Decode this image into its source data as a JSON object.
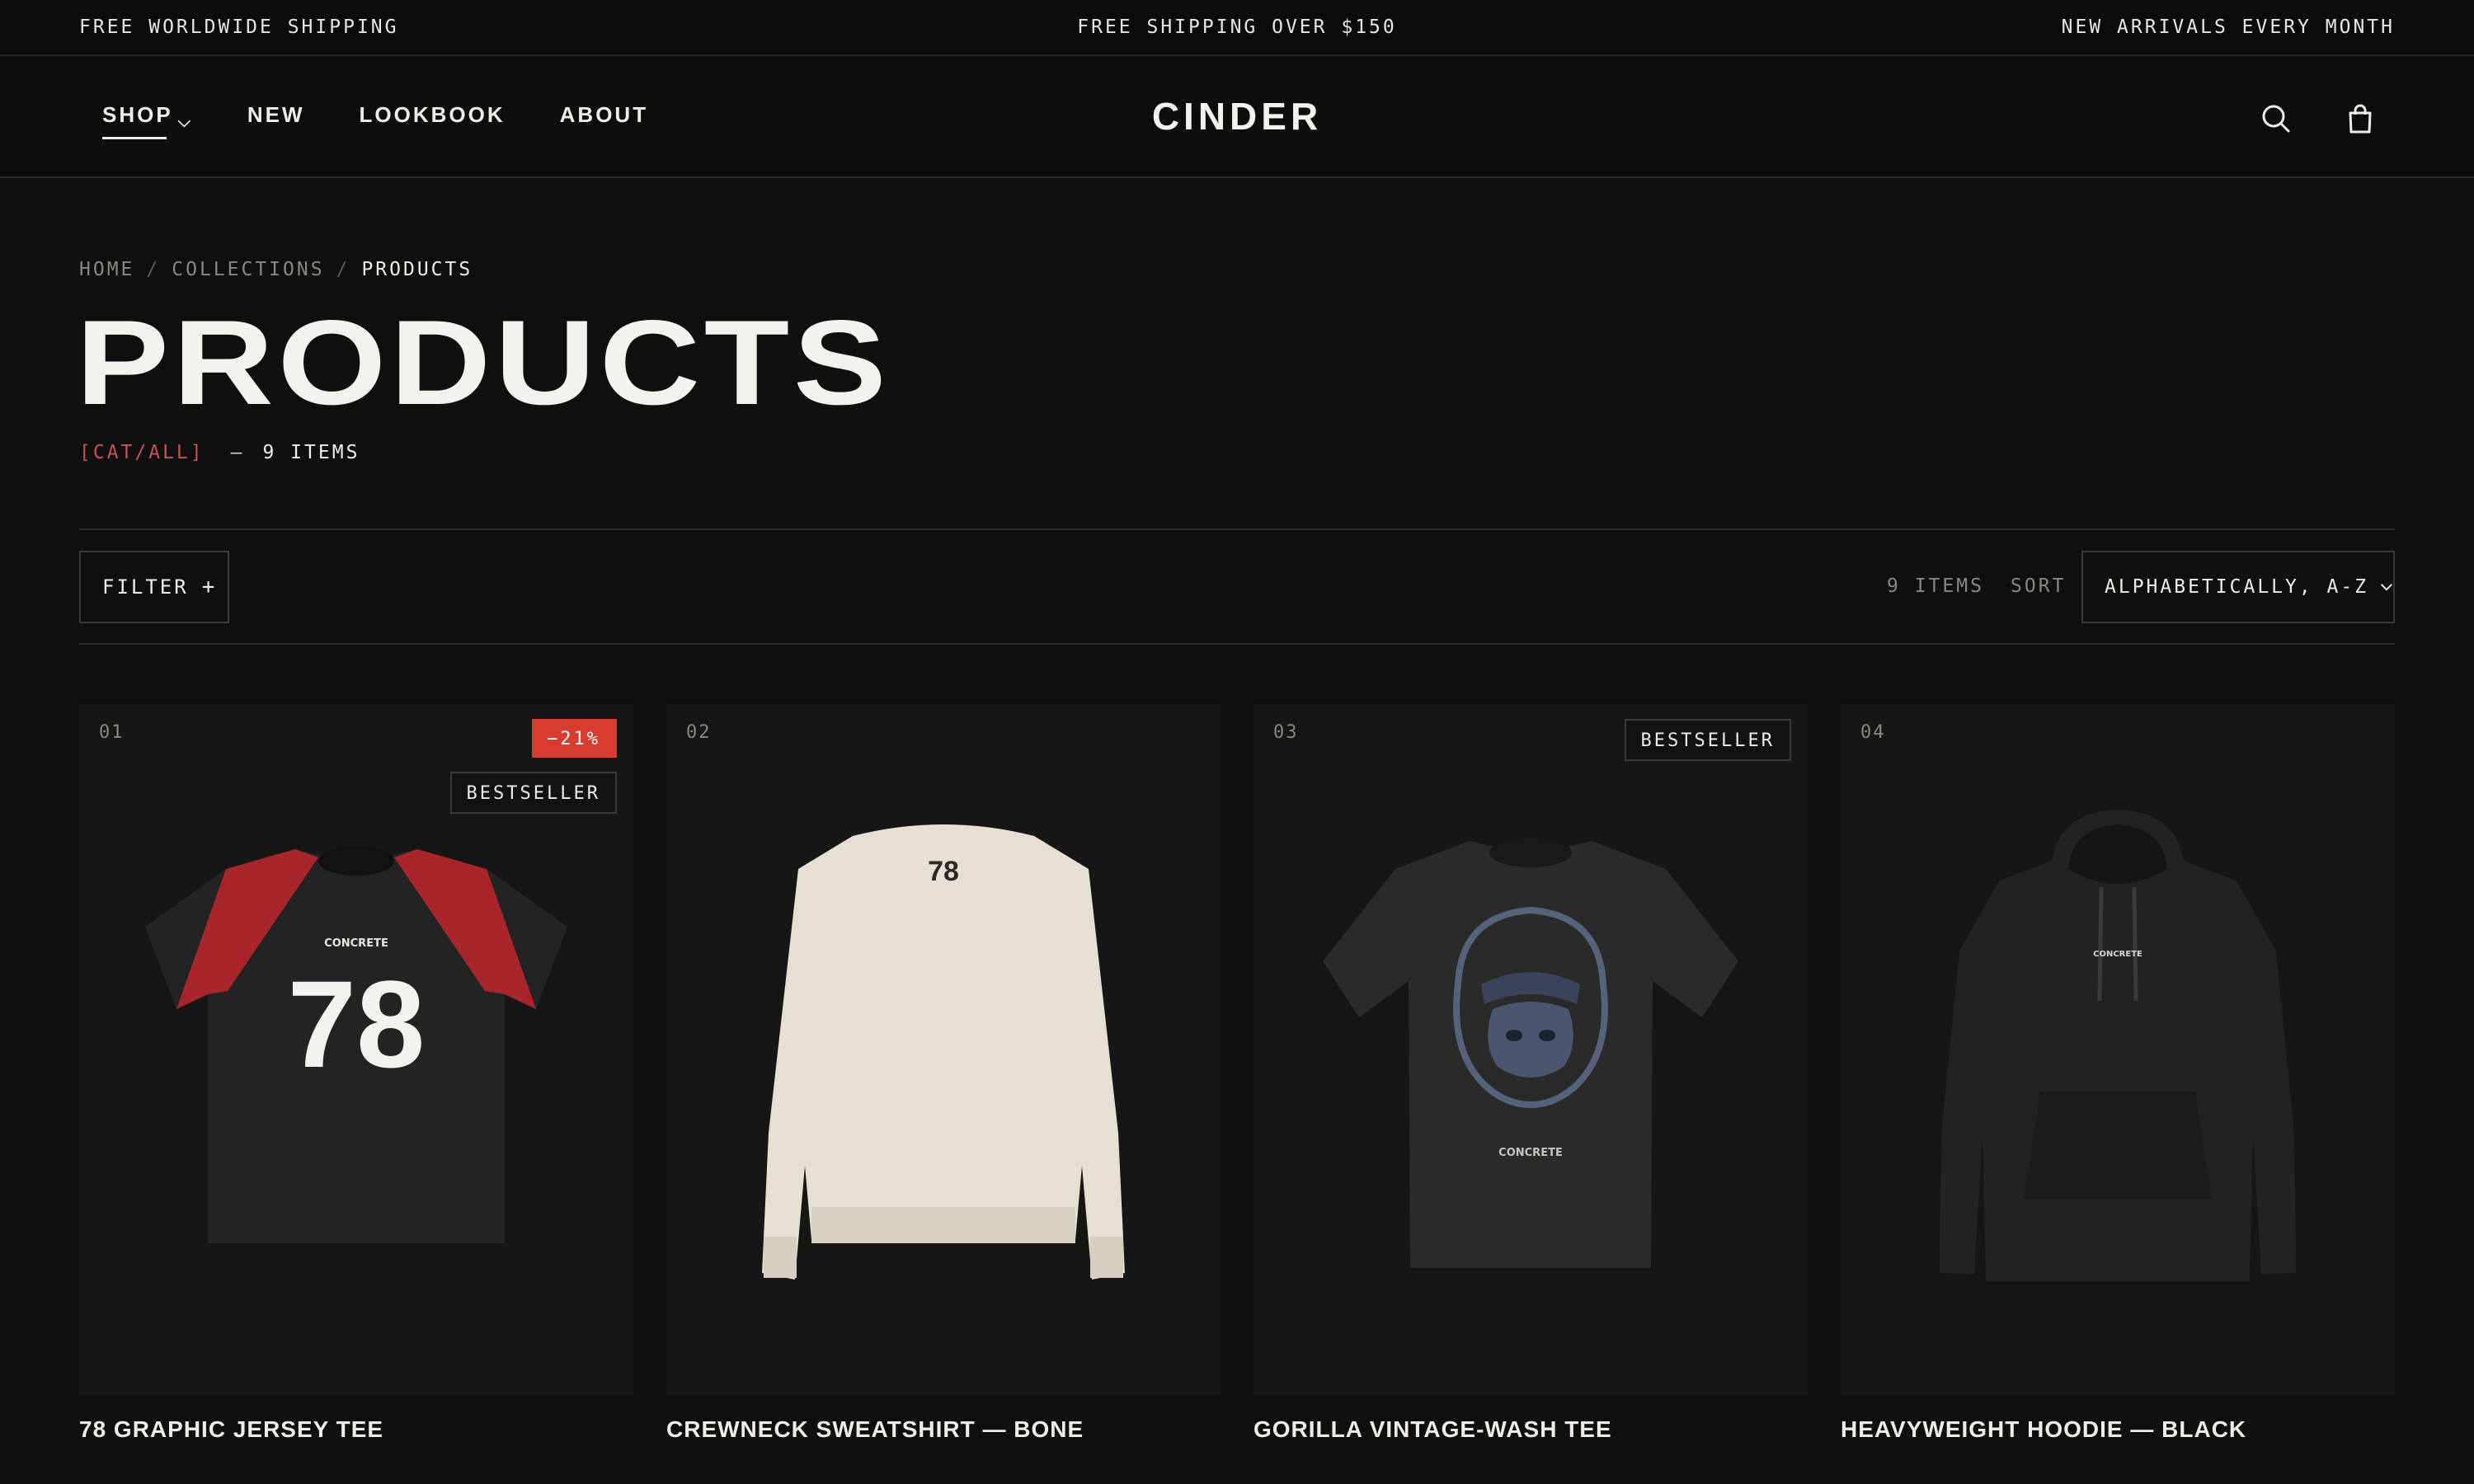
{
  "announcement": {
    "left": "FREE WORLDWIDE SHIPPING",
    "center": "FREE SHIPPING OVER $150",
    "right": "NEW ARRIVALS EVERY MONTH"
  },
  "header": {
    "logo": "CINDER",
    "nav": [
      {
        "label": "SHOP",
        "active": true,
        "has_dropdown": true
      },
      {
        "label": "NEW"
      },
      {
        "label": "LOOKBOOK"
      },
      {
        "label": "ABOUT"
      }
    ],
    "icons": [
      "search-icon",
      "bag-icon"
    ]
  },
  "breadcrumb": [
    "HOME",
    "COLLECTIONS",
    "PRODUCTS"
  ],
  "breadcrumb_sep": "/",
  "page": {
    "title": "PRODUCTS",
    "category": "[CAT/ALL]",
    "dash": "—",
    "item_count": "9 ITEMS"
  },
  "toolbar": {
    "filter_label": "FILTER",
    "filter_plus": "+",
    "items_count": "9 ITEMS",
    "sort_label": "SORT",
    "sort_value": "ALPHABETICALLY, A-Z"
  },
  "products": [
    {
      "num": "01",
      "name": "78 GRAPHIC JERSEY TEE",
      "badge_sale": "−21%",
      "badge_best": "BESTSELLER",
      "print_brand": "CONCRETE",
      "print_number": "78"
    },
    {
      "num": "02",
      "name": "CREWNECK SWEATSHIRT — BONE",
      "print_number": "78"
    },
    {
      "num": "03",
      "name": "GORILLA VINTAGE-WASH TEE",
      "badge_best": "BESTSELLER",
      "print_brand": "CONCRETE"
    },
    {
      "num": "04",
      "name": "HEAVYWEIGHT HOODIE — BLACK",
      "print_brand": "CONCRETE"
    }
  ],
  "colors": {
    "background": "#0f0f0f",
    "text": "#f0ede6",
    "muted": "#8a8780",
    "accent_red": "#d93b30",
    "category_red": "#c5564d"
  }
}
